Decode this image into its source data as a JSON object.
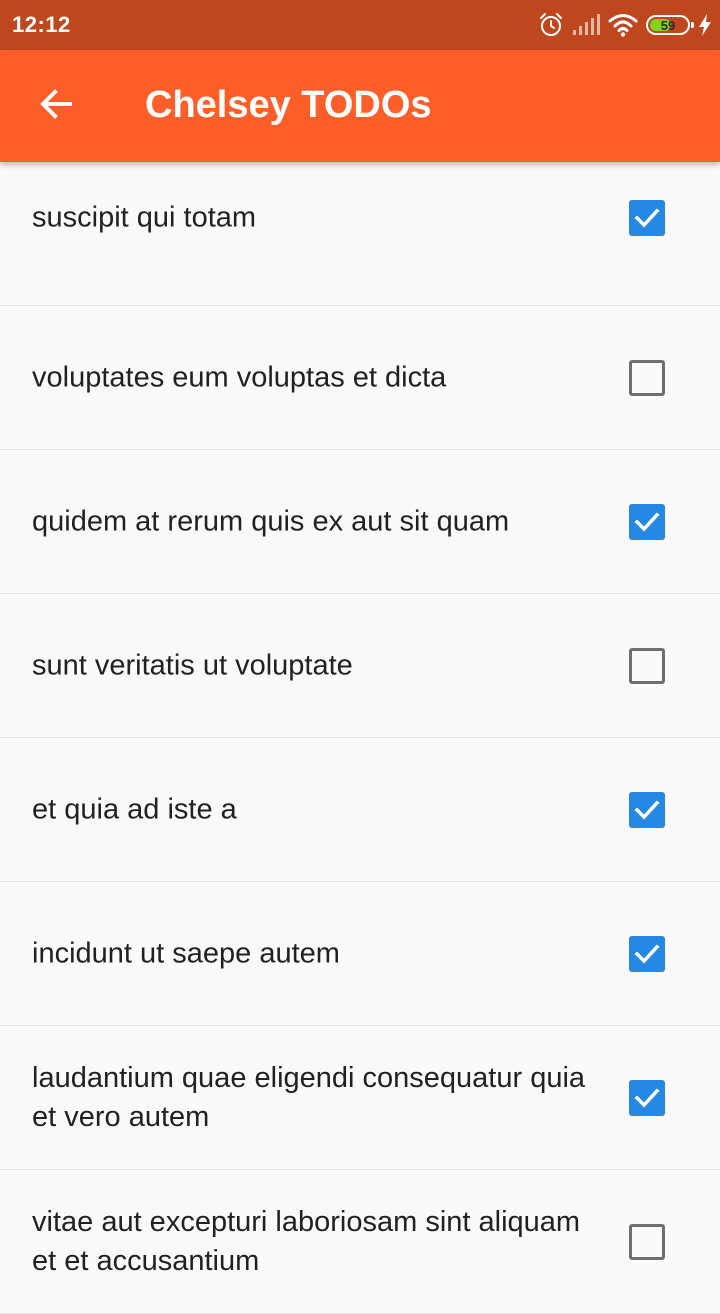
{
  "status_bar": {
    "time": "12:12",
    "battery_level": "59",
    "battery_fraction": 0.59,
    "icons": [
      "alarm-icon",
      "signal-icon",
      "wifi-icon",
      "battery-icon",
      "charging-icon"
    ]
  },
  "app_bar": {
    "title": "Chelsey TODOs",
    "back_icon": "arrow-left-icon",
    "color": "#FF5E29"
  },
  "colors": {
    "status_bar": "#BF471E",
    "checkbox_checked": "#2588E5",
    "checkbox_unchecked_border": "#6E6E6E",
    "background": "#FAFAFA"
  },
  "todos": [
    {
      "title": "suscipit qui totam",
      "completed": true
    },
    {
      "title": "voluptates eum voluptas et dicta",
      "completed": false
    },
    {
      "title": "quidem at rerum quis ex aut sit quam",
      "completed": true
    },
    {
      "title": "sunt veritatis ut voluptate",
      "completed": false
    },
    {
      "title": "et quia ad iste a",
      "completed": true
    },
    {
      "title": "incidunt ut saepe autem",
      "completed": true
    },
    {
      "title": "laudantium quae eligendi consequatur quia et vero autem",
      "completed": true
    },
    {
      "title": "vitae aut excepturi laboriosam sint aliquam et et accusantium",
      "completed": false
    }
  ]
}
